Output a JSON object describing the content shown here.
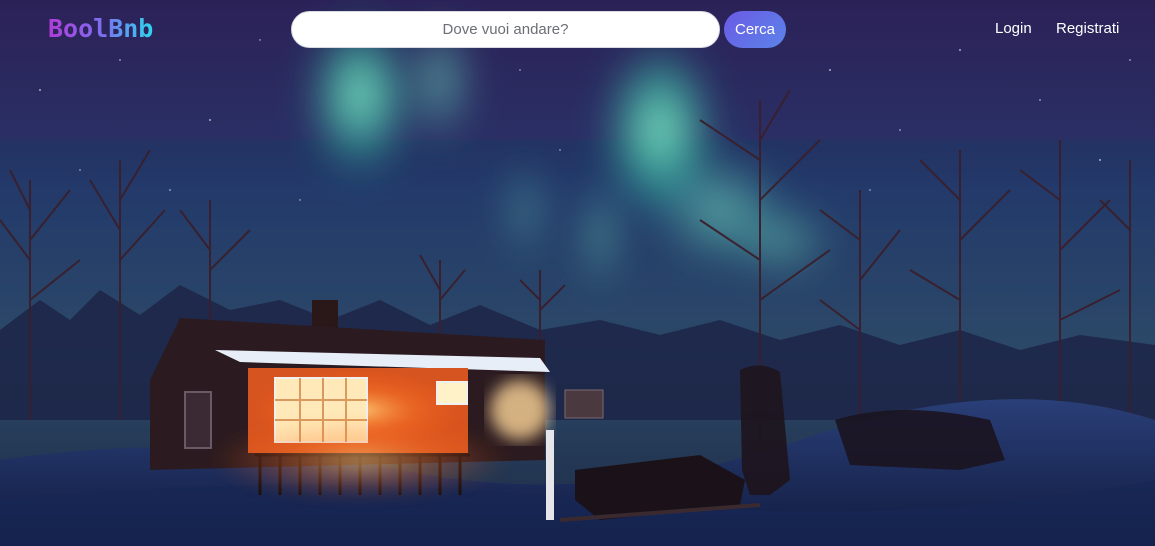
{
  "navbar": {
    "logo": "BoolBnb",
    "search": {
      "placeholder": "Dove vuoi andare?",
      "value": ""
    },
    "search_button_label": "Cerca",
    "links": {
      "login": "Login",
      "register": "Registrati"
    }
  },
  "hero": {
    "image": "aurora-borealis-cabin-night-photo"
  },
  "colors": {
    "logo_gradient_start": "#b13bd8",
    "logo_gradient_end": "#2fd6ee",
    "search_button": "#6b5ae6",
    "nav_text": "#ffffff"
  }
}
